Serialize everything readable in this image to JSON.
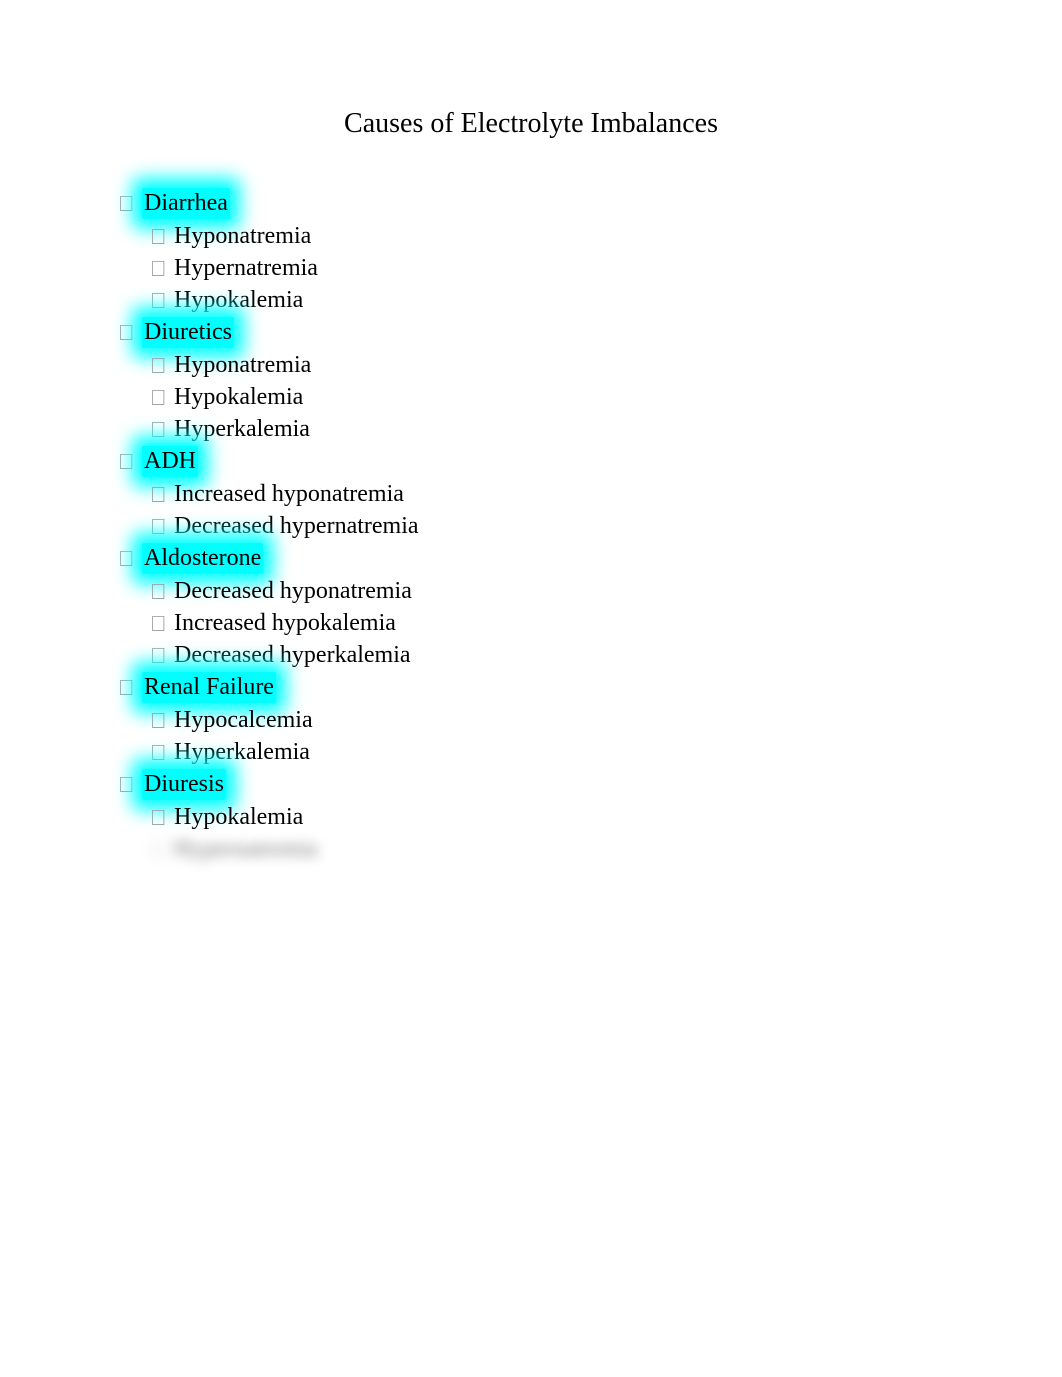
{
  "title": "Causes of Electrolyte Imbalances",
  "sections": [
    {
      "heading": "Diarrhea",
      "items": [
        "Hyponatremia",
        "Hypernatremia",
        "Hypokalemia"
      ]
    },
    {
      "heading": "Diuretics",
      "items": [
        "Hyponatremia",
        "Hypokalemia",
        "Hyperkalemia"
      ]
    },
    {
      "heading": "ADH",
      "items": [
        "Increased hyponatremia",
        "Decreased hypernatremia"
      ]
    },
    {
      "heading": "Aldosterone",
      "items": [
        "Decreased hyponatremia",
        "Increased hypokalemia",
        "Decreased hyperkalemia"
      ]
    },
    {
      "heading": "Renal Failure",
      "items": [
        "Hypocalcemia",
        "Hyperkalemia"
      ]
    },
    {
      "heading": "Diuresis",
      "items": [
        "Hypokalemia",
        "Hypernatremia"
      ],
      "last_blurred": true
    }
  ]
}
